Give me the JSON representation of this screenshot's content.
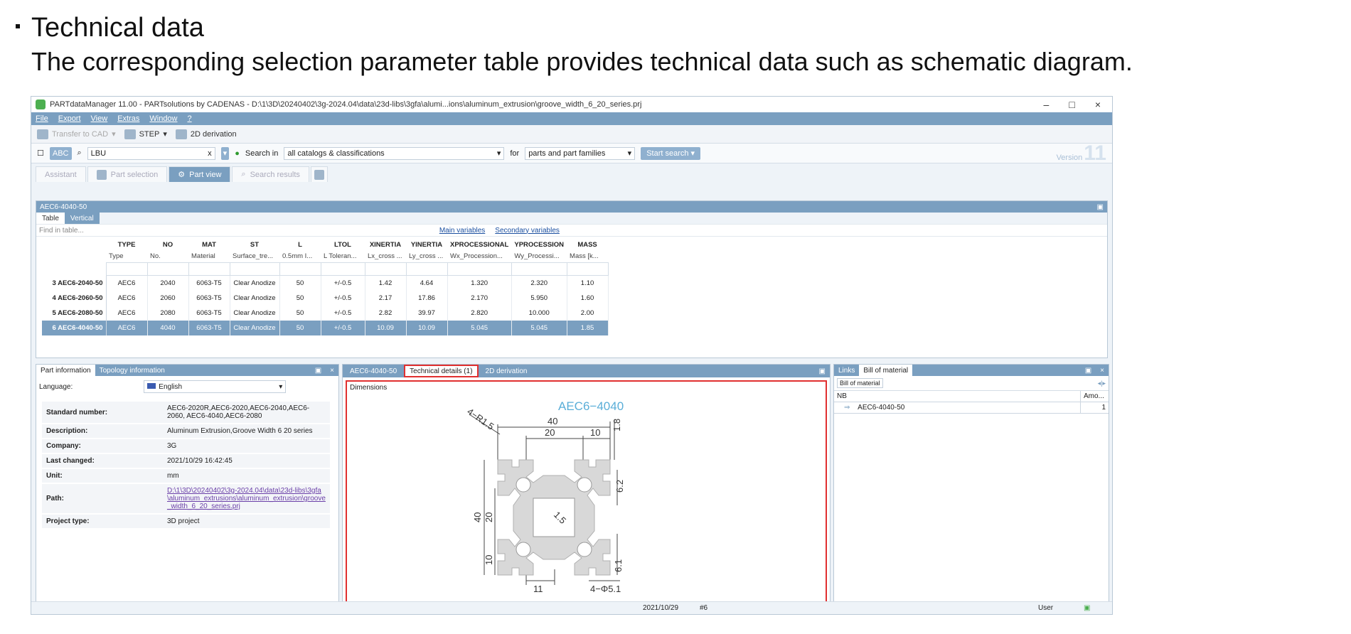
{
  "slide": {
    "title": "Technical data",
    "subtitle": "The corresponding selection parameter table provides technical data such as schematic diagram."
  },
  "window": {
    "title": "PARTdataManager 11.00 - PARTsolutions by CADENAS - D:\\1\\3D\\20240402\\3g-2024.04\\data\\23d-libs\\3gfa\\alumi...ions\\aluminum_extrusion\\groove_width_6_20_series.prj",
    "controls": [
      "–",
      "□",
      "×"
    ]
  },
  "menu": [
    "File",
    "Export",
    "View",
    "Extras",
    "Window",
    "?"
  ],
  "toolbar": {
    "transfer": "Transfer to CAD",
    "step": "STEP",
    "derivation": "2D derivation"
  },
  "search": {
    "value": "LBU",
    "clear": "x",
    "search_in_label": "Search in",
    "scope": "all catalogs & classifications",
    "for_label": "for",
    "target": "parts and part families",
    "start": "Start search",
    "version_label": "Version",
    "version_num": "11"
  },
  "main_tabs": [
    "Assistant",
    "Part selection",
    "Part view",
    "Search results"
  ],
  "table_pane": {
    "title": "AEC6-4040-50",
    "tabs": [
      "Table",
      "Vertical"
    ],
    "find_placeholder": "Find in table...",
    "main_vars": "Main variables",
    "secondary_vars": "Secondary variables",
    "headers": [
      "TYPE",
      "NO",
      "MAT",
      "ST",
      "L",
      "LTOL",
      "XINERTIA",
      "YINERTIA",
      "XPROCESSIONAL",
      "YPROCESSION",
      "MASS"
    ],
    "subheaders": [
      "Type",
      "No.",
      "Material",
      "Surface_tre...",
      "0.5mm I...",
      "L Toleran...",
      "Lx_cross ...",
      "Ly_cross ...",
      "Wx_Procession...",
      "Wy_Processi...",
      "Mass [k..."
    ],
    "rows": [
      {
        "id": "3",
        "name": "AEC6-2040-50",
        "cells": [
          "AEC6",
          "2040",
          "6063-T5",
          "Clear Anodize",
          "50",
          "+/-0.5",
          "1.42",
          "4.64",
          "1.320",
          "2.320",
          "1.10"
        ]
      },
      {
        "id": "4",
        "name": "AEC6-2060-50",
        "cells": [
          "AEC6",
          "2060",
          "6063-T5",
          "Clear Anodize",
          "50",
          "+/-0.5",
          "2.17",
          "17.86",
          "2.170",
          "5.950",
          "1.60"
        ]
      },
      {
        "id": "5",
        "name": "AEC6-2080-50",
        "cells": [
          "AEC6",
          "2080",
          "6063-T5",
          "Clear Anodize",
          "50",
          "+/-0.5",
          "2.82",
          "39.97",
          "2.820",
          "10.000",
          "2.00"
        ]
      },
      {
        "id": "6",
        "name": "AEC6-4040-50",
        "cells": [
          "AEC6",
          "4040",
          "6063-T5",
          "Clear Anodize",
          "50",
          "+/-0.5",
          "10.09",
          "10.09",
          "5.045",
          "5.045",
          "1.85"
        ]
      }
    ]
  },
  "info_pane": {
    "tabs": [
      "Part information",
      "Topology information"
    ],
    "language_label": "Language:",
    "language": "English",
    "props": [
      {
        "k": "Standard number:",
        "v": "AEC6-2020R,AEC6-2020,AEC6-2040,AEC6-2060, AEC6-4040,AEC6-2080"
      },
      {
        "k": "Description:",
        "v": "Aluminum Extrusion,Groove Width 6 20 series"
      },
      {
        "k": "Company:",
        "v": "3G"
      },
      {
        "k": "Last changed:",
        "v": "2021/10/29 16:42:45"
      },
      {
        "k": "Unit:",
        "v": "mm"
      },
      {
        "k": "Path:",
        "v": "D:\\1\\3D\\20240402\\3g-2024.04\\data\\23d-libs\\3gfa\\aluminum_extrusions\\aluminum_extrusion\\groove_width_6_20_series.prj"
      },
      {
        "k": "Project type:",
        "v": "3D project"
      }
    ]
  },
  "tech_pane": {
    "tabs": [
      "AEC6-4040-50",
      "Technical details (1)",
      "2D derivation"
    ],
    "section": "Dimensions",
    "drawing": {
      "title": "AEC6−4040",
      "d40_top": "40",
      "d20": "20",
      "d10": "10",
      "d1_8": "1.8",
      "d6_2": "6.2",
      "d40_side": "40",
      "d20_side": "20",
      "d10_side": "10",
      "d6_1": "6.1",
      "d11": "11",
      "d1_5": "1.5",
      "r1_5": "4−R1.5",
      "hole": "4−Φ5.1"
    }
  },
  "bom_pane": {
    "tabs": [
      "Links",
      "Bill of material"
    ],
    "sub_tab": "Bill of material",
    "col_nb": "NB",
    "col_amount": "Amo...",
    "item": "AEC6-4040-50",
    "qty": "1"
  },
  "status": {
    "date": "2021/10/29",
    "rev": "#6",
    "user": "User"
  }
}
